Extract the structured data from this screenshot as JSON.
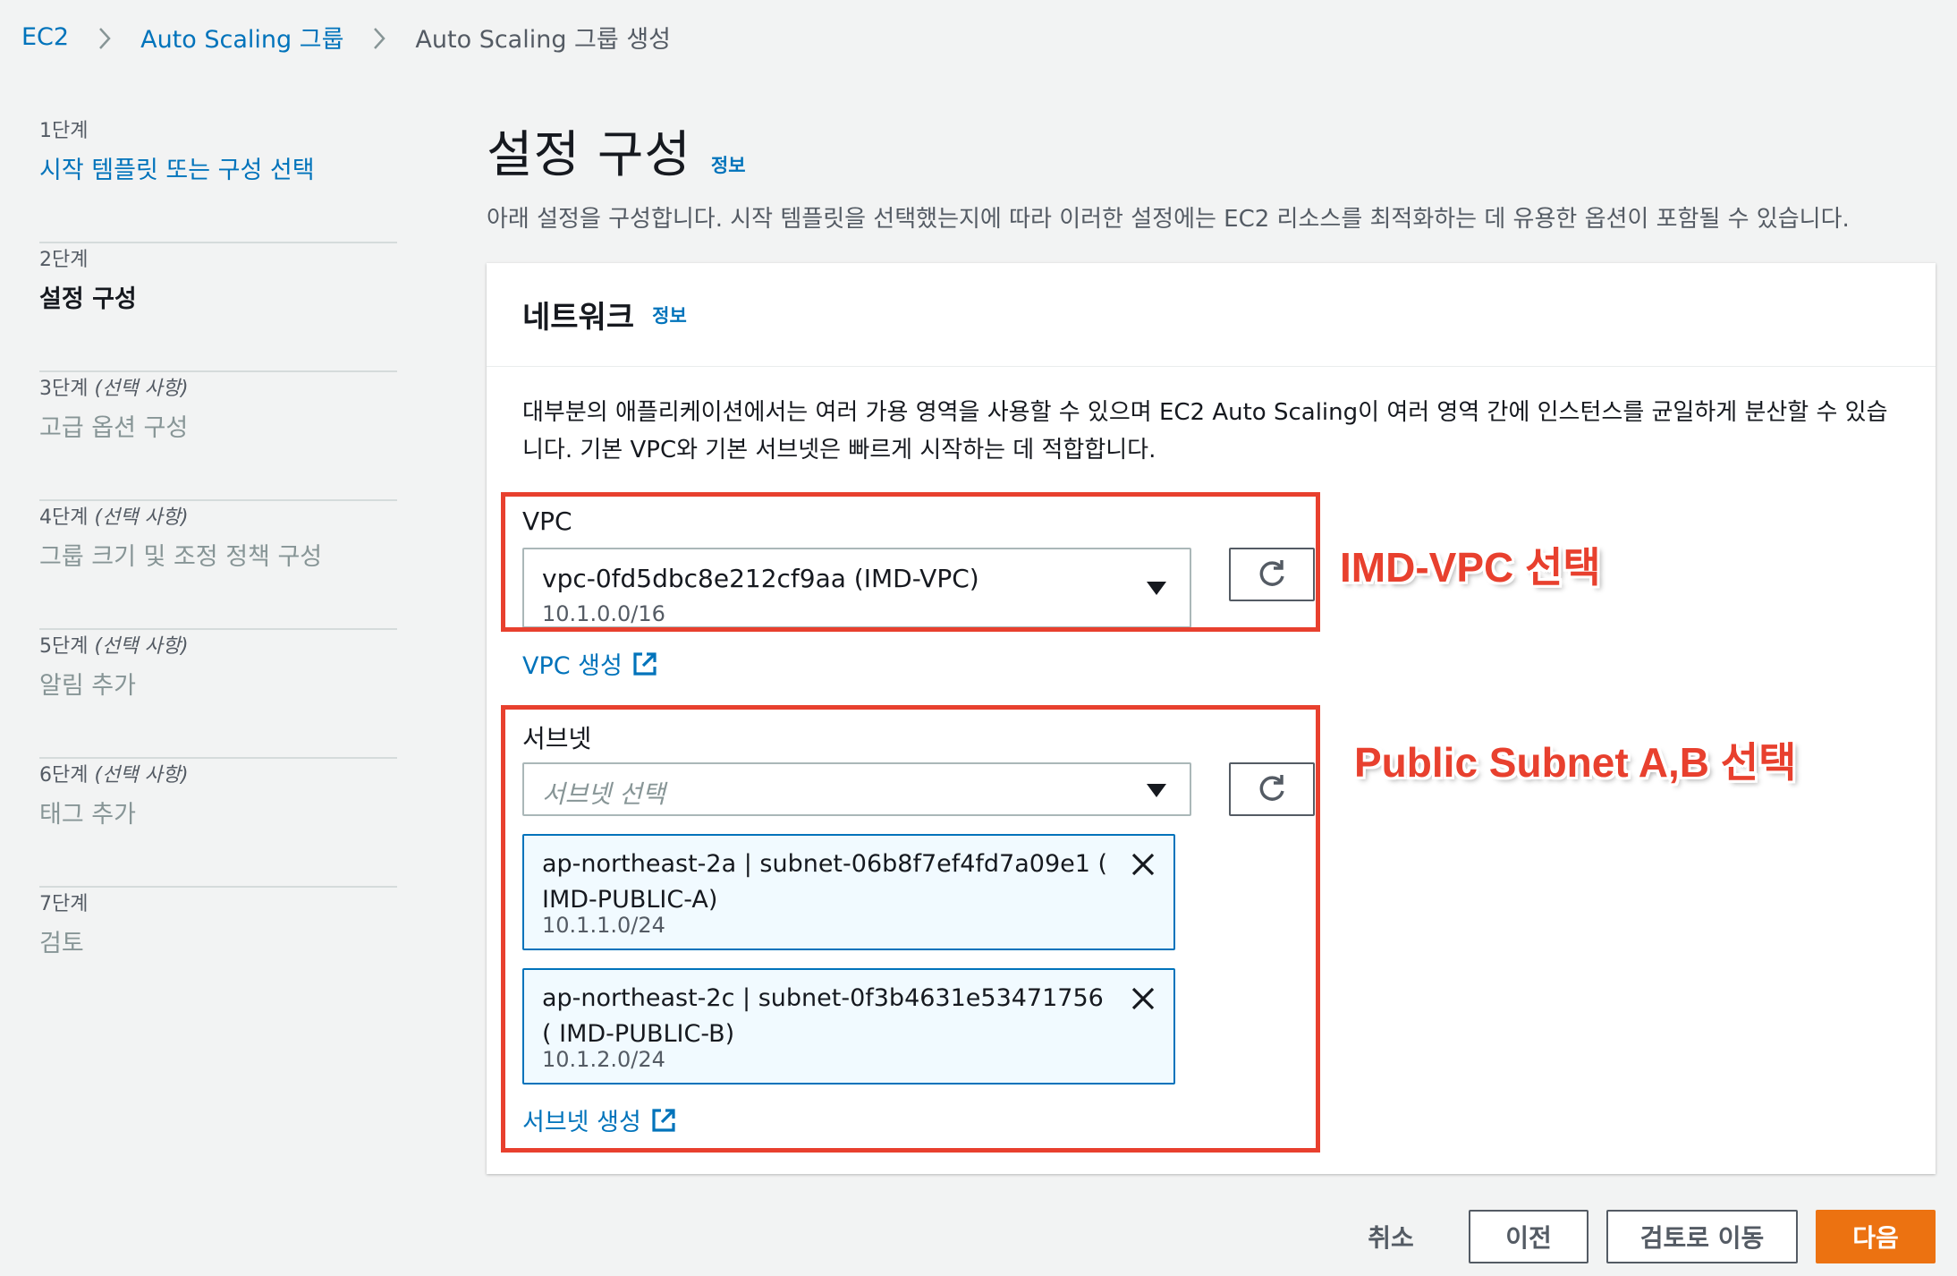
{
  "breadcrumb": {
    "items": [
      "EC2",
      "Auto Scaling 그룹",
      "Auto Scaling 그룹 생성"
    ]
  },
  "steps": [
    {
      "num": "1단계",
      "optional": "",
      "title": "시작 템플릿 또는 구성 선택"
    },
    {
      "num": "2단계",
      "optional": "",
      "title": "설정 구성"
    },
    {
      "num": "3단계",
      "optional": "(선택 사항)",
      "title": "고급 옵션 구성"
    },
    {
      "num": "4단계",
      "optional": "(선택 사항)",
      "title": "그룹 크기 및 조정 정책 구성"
    },
    {
      "num": "5단계",
      "optional": "(선택 사항)",
      "title": "알림 추가"
    },
    {
      "num": "6단계",
      "optional": "(선택 사항)",
      "title": "태그 추가"
    },
    {
      "num": "7단계",
      "optional": "",
      "title": "검토"
    }
  ],
  "page": {
    "title": "설정 구성",
    "info": "정보",
    "description": "아래 설정을 구성합니다. 시작 템플릿을 선택했는지에 따라 이러한 설정에는 EC2 리소스를 최적화하는 데 유용한 옵션이 포함될 수 있습니다."
  },
  "network": {
    "title": "네트워크",
    "info": "정보",
    "description": "대부분의 애플리케이션에서는 여러 가용 영역을 사용할 수 있으며 EC2 Auto Scaling이 여러 영역 간에 인스턴스를 균일하게 분산할 수 있습니다. 기본 VPC와 기본 서브넷은 빠르게 시작하는 데 적합합니다.",
    "vpc": {
      "label": "VPC",
      "value": "vpc-0fd5dbc8e212cf9aa (IMD-VPC)",
      "cidr": "10.1.0.0/16",
      "create_link": "VPC 생성"
    },
    "subnet": {
      "label": "서브넷",
      "placeholder": "서브넷 선택",
      "selected": [
        {
          "label": "ap-northeast-2a | subnet-06b8f7ef4fd7a09e1 ( IMD-PUBLIC-A)",
          "cidr": "10.1.1.0/24"
        },
        {
          "label": "ap-northeast-2c | subnet-0f3b4631e53471756 ( IMD-PUBLIC-B)",
          "cidr": "10.1.2.0/24"
        }
      ],
      "create_link": "서브넷 생성"
    }
  },
  "annotations": {
    "vpc_note": "IMD-VPC 선택",
    "subnet_note": "Public Subnet A,B 선택"
  },
  "footer": {
    "cancel": "취소",
    "previous": "이전",
    "review": "검토로 이동",
    "next": "다음"
  },
  "colors": {
    "link": "#0073bb",
    "primary_button": "#ec7211",
    "annotation": "#e8402e",
    "token_bg": "#f1faff"
  }
}
